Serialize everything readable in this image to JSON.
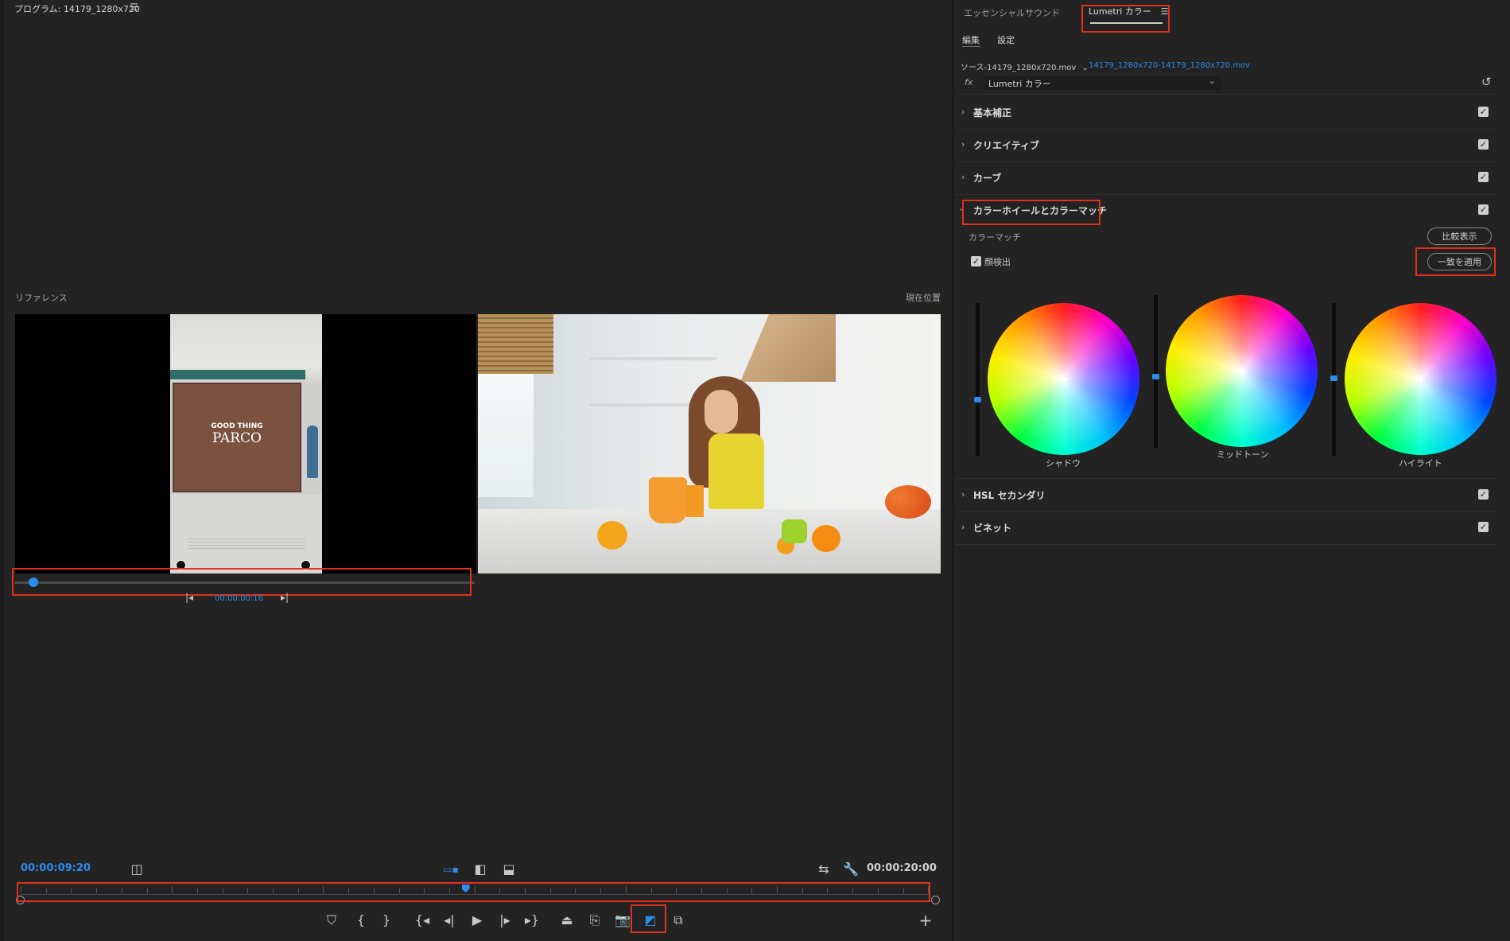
{
  "program_monitor": {
    "title": "プログラム: 14179_1280x720",
    "reference_label": "リファレンス",
    "current_label": "現在位置",
    "ref_timecode": "00:00:00:16",
    "current_timecode": "00:00:09:20",
    "duration": "00:00:20:00",
    "ref_scrub_position": 0.04,
    "playhead_position": 0.49
  },
  "reference_image": {
    "sign_line1": "GOOD THING",
    "sign_line2": "PARCO"
  },
  "lumetri": {
    "tabs": [
      "エッセンシャルサウンド",
      "Lumetri カラー"
    ],
    "subtabs": [
      "編集",
      "設定"
    ],
    "source_label": "ソース-14179_1280x720.mov",
    "clip_link": "14179_1280x720-14179_1280x720.mov",
    "fx_label": "fx",
    "effect_select": "Lumetri カラー",
    "sections": [
      "基本補正",
      "クリエイティブ",
      "カーブ",
      "カラーホイールとカラーマッチ",
      "HSL セカンダリ",
      "ビネット"
    ],
    "color_match_label": "カラーマッチ",
    "compare_button": "比較表示",
    "face_detect_label": "顔検出",
    "apply_match_button": "一致を適用",
    "wheels": [
      "シャドウ",
      "ミッドトーン",
      "ハイライト"
    ]
  },
  "colors": {
    "accent": "#2d8ceb",
    "highlight_box": "#e0301e",
    "panel_bg": "#232323"
  }
}
